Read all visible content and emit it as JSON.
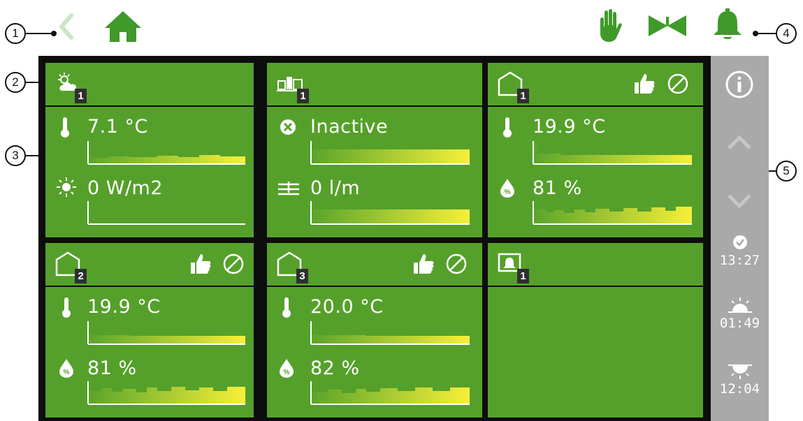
{
  "callouts": [
    "1",
    "2",
    "3",
    "4",
    "5"
  ],
  "topbar": {
    "back_icon": "chevron-left-icon",
    "home_icon": "home-icon",
    "manual_icon": "hand-icon",
    "valve_icon": "valve-icon",
    "alarm_icon": "bell-icon"
  },
  "tiles": [
    {
      "name": "weather",
      "icon": "weather-icon",
      "badge": "1",
      "rows": [
        {
          "icon": "thermometer-icon",
          "value": "7.1 °C"
        },
        {
          "icon": "sun-icon",
          "value": "0 W/m2"
        }
      ]
    },
    {
      "name": "irrigation",
      "icon": "irrigation-icon",
      "badge": "1",
      "rows": [
        {
          "icon": "inactive-x-icon",
          "value": "Inactive"
        },
        {
          "icon": "flow-icon",
          "value": "0 l/m"
        }
      ]
    },
    {
      "name": "greenhouse-1",
      "icon": "greenhouse-icon",
      "badge": "1",
      "rows": [
        {
          "icon": "thermometer-icon",
          "value": "19.9 °C"
        },
        {
          "icon": "humidity-icon",
          "value": "81 %"
        }
      ]
    },
    {
      "name": "greenhouse-2",
      "icon": "greenhouse-icon",
      "badge": "2",
      "rows": [
        {
          "icon": "thermometer-icon",
          "value": "19.9 °C"
        },
        {
          "icon": "humidity-icon",
          "value": "81 %"
        }
      ]
    },
    {
      "name": "greenhouse-3",
      "icon": "greenhouse-icon",
      "badge": "3",
      "rows": [
        {
          "icon": "thermometer-icon",
          "value": "20.0 °C"
        },
        {
          "icon": "humidity-icon",
          "value": "82 %"
        }
      ]
    },
    {
      "name": "alarm-screen",
      "icon": "alarm-screen-icon",
      "badge": "1",
      "rows": []
    }
  ],
  "side": {
    "info_icon": "info-icon",
    "up_icon": "chevron-up-icon",
    "down_icon": "chevron-down-icon",
    "clock_time": "13:27",
    "sunrise_time": "01:49",
    "sunset_time": "12:04"
  },
  "colors": {
    "tile_green": "#55a02a",
    "icon_green": "#3f9a2a",
    "back_arrow_disabled": "#c9e6c2",
    "frame_black": "#0d0d0d",
    "side_gray": "#a9a9a9",
    "spark_start": "#55a02a",
    "spark_end": "#f7ef3a"
  }
}
